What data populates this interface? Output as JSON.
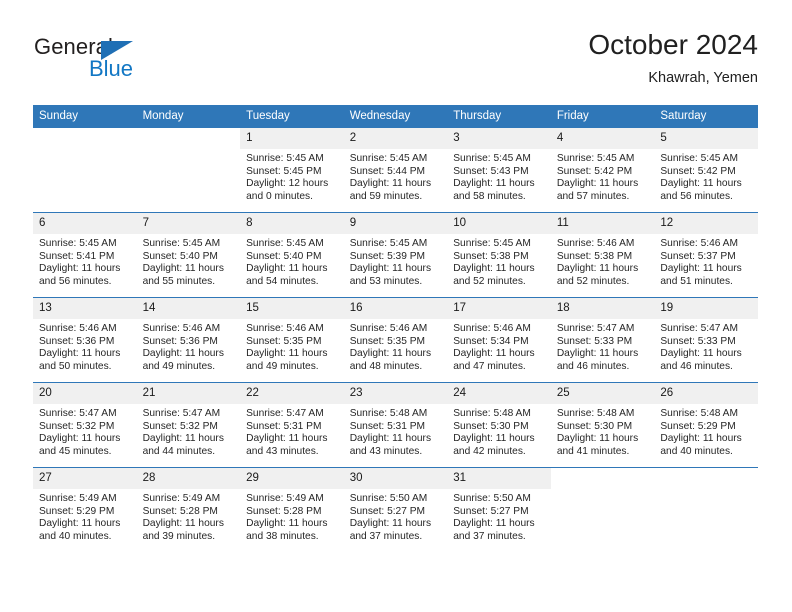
{
  "brand": {
    "name_top": "General",
    "name_bottom": "Blue",
    "color_primary": "#1277c4",
    "color_dark": "#221f1f"
  },
  "header": {
    "title": "October 2024",
    "subtitle": "Khawrah, Yemen"
  },
  "calendar": {
    "header_color": "#2f77b8",
    "daynum_band_color": "#f0f0f0",
    "weekdays": [
      "Sunday",
      "Monday",
      "Tuesday",
      "Wednesday",
      "Thursday",
      "Friday",
      "Saturday"
    ],
    "weeks": [
      [
        {
          "day": "",
          "lines": []
        },
        {
          "day": "",
          "lines": []
        },
        {
          "day": "1",
          "lines": [
            "Sunrise: 5:45 AM",
            "Sunset: 5:45 PM",
            "Daylight: 12 hours",
            "and 0 minutes."
          ]
        },
        {
          "day": "2",
          "lines": [
            "Sunrise: 5:45 AM",
            "Sunset: 5:44 PM",
            "Daylight: 11 hours",
            "and 59 minutes."
          ]
        },
        {
          "day": "3",
          "lines": [
            "Sunrise: 5:45 AM",
            "Sunset: 5:43 PM",
            "Daylight: 11 hours",
            "and 58 minutes."
          ]
        },
        {
          "day": "4",
          "lines": [
            "Sunrise: 5:45 AM",
            "Sunset: 5:42 PM",
            "Daylight: 11 hours",
            "and 57 minutes."
          ]
        },
        {
          "day": "5",
          "lines": [
            "Sunrise: 5:45 AM",
            "Sunset: 5:42 PM",
            "Daylight: 11 hours",
            "and 56 minutes."
          ]
        }
      ],
      [
        {
          "day": "6",
          "lines": [
            "Sunrise: 5:45 AM",
            "Sunset: 5:41 PM",
            "Daylight: 11 hours",
            "and 56 minutes."
          ]
        },
        {
          "day": "7",
          "lines": [
            "Sunrise: 5:45 AM",
            "Sunset: 5:40 PM",
            "Daylight: 11 hours",
            "and 55 minutes."
          ]
        },
        {
          "day": "8",
          "lines": [
            "Sunrise: 5:45 AM",
            "Sunset: 5:40 PM",
            "Daylight: 11 hours",
            "and 54 minutes."
          ]
        },
        {
          "day": "9",
          "lines": [
            "Sunrise: 5:45 AM",
            "Sunset: 5:39 PM",
            "Daylight: 11 hours",
            "and 53 minutes."
          ]
        },
        {
          "day": "10",
          "lines": [
            "Sunrise: 5:45 AM",
            "Sunset: 5:38 PM",
            "Daylight: 11 hours",
            "and 52 minutes."
          ]
        },
        {
          "day": "11",
          "lines": [
            "Sunrise: 5:46 AM",
            "Sunset: 5:38 PM",
            "Daylight: 11 hours",
            "and 52 minutes."
          ]
        },
        {
          "day": "12",
          "lines": [
            "Sunrise: 5:46 AM",
            "Sunset: 5:37 PM",
            "Daylight: 11 hours",
            "and 51 minutes."
          ]
        }
      ],
      [
        {
          "day": "13",
          "lines": [
            "Sunrise: 5:46 AM",
            "Sunset: 5:36 PM",
            "Daylight: 11 hours",
            "and 50 minutes."
          ]
        },
        {
          "day": "14",
          "lines": [
            "Sunrise: 5:46 AM",
            "Sunset: 5:36 PM",
            "Daylight: 11 hours",
            "and 49 minutes."
          ]
        },
        {
          "day": "15",
          "lines": [
            "Sunrise: 5:46 AM",
            "Sunset: 5:35 PM",
            "Daylight: 11 hours",
            "and 49 minutes."
          ]
        },
        {
          "day": "16",
          "lines": [
            "Sunrise: 5:46 AM",
            "Sunset: 5:35 PM",
            "Daylight: 11 hours",
            "and 48 minutes."
          ]
        },
        {
          "day": "17",
          "lines": [
            "Sunrise: 5:46 AM",
            "Sunset: 5:34 PM",
            "Daylight: 11 hours",
            "and 47 minutes."
          ]
        },
        {
          "day": "18",
          "lines": [
            "Sunrise: 5:47 AM",
            "Sunset: 5:33 PM",
            "Daylight: 11 hours",
            "and 46 minutes."
          ]
        },
        {
          "day": "19",
          "lines": [
            "Sunrise: 5:47 AM",
            "Sunset: 5:33 PM",
            "Daylight: 11 hours",
            "and 46 minutes."
          ]
        }
      ],
      [
        {
          "day": "20",
          "lines": [
            "Sunrise: 5:47 AM",
            "Sunset: 5:32 PM",
            "Daylight: 11 hours",
            "and 45 minutes."
          ]
        },
        {
          "day": "21",
          "lines": [
            "Sunrise: 5:47 AM",
            "Sunset: 5:32 PM",
            "Daylight: 11 hours",
            "and 44 minutes."
          ]
        },
        {
          "day": "22",
          "lines": [
            "Sunrise: 5:47 AM",
            "Sunset: 5:31 PM",
            "Daylight: 11 hours",
            "and 43 minutes."
          ]
        },
        {
          "day": "23",
          "lines": [
            "Sunrise: 5:48 AM",
            "Sunset: 5:31 PM",
            "Daylight: 11 hours",
            "and 43 minutes."
          ]
        },
        {
          "day": "24",
          "lines": [
            "Sunrise: 5:48 AM",
            "Sunset: 5:30 PM",
            "Daylight: 11 hours",
            "and 42 minutes."
          ]
        },
        {
          "day": "25",
          "lines": [
            "Sunrise: 5:48 AM",
            "Sunset: 5:30 PM",
            "Daylight: 11 hours",
            "and 41 minutes."
          ]
        },
        {
          "day": "26",
          "lines": [
            "Sunrise: 5:48 AM",
            "Sunset: 5:29 PM",
            "Daylight: 11 hours",
            "and 40 minutes."
          ]
        }
      ],
      [
        {
          "day": "27",
          "lines": [
            "Sunrise: 5:49 AM",
            "Sunset: 5:29 PM",
            "Daylight: 11 hours",
            "and 40 minutes."
          ]
        },
        {
          "day": "28",
          "lines": [
            "Sunrise: 5:49 AM",
            "Sunset: 5:28 PM",
            "Daylight: 11 hours",
            "and 39 minutes."
          ]
        },
        {
          "day": "29",
          "lines": [
            "Sunrise: 5:49 AM",
            "Sunset: 5:28 PM",
            "Daylight: 11 hours",
            "and 38 minutes."
          ]
        },
        {
          "day": "30",
          "lines": [
            "Sunrise: 5:50 AM",
            "Sunset: 5:27 PM",
            "Daylight: 11 hours",
            "and 37 minutes."
          ]
        },
        {
          "day": "31",
          "lines": [
            "Sunrise: 5:50 AM",
            "Sunset: 5:27 PM",
            "Daylight: 11 hours",
            "and 37 minutes."
          ]
        },
        {
          "day": "",
          "lines": []
        },
        {
          "day": "",
          "lines": []
        }
      ]
    ]
  }
}
